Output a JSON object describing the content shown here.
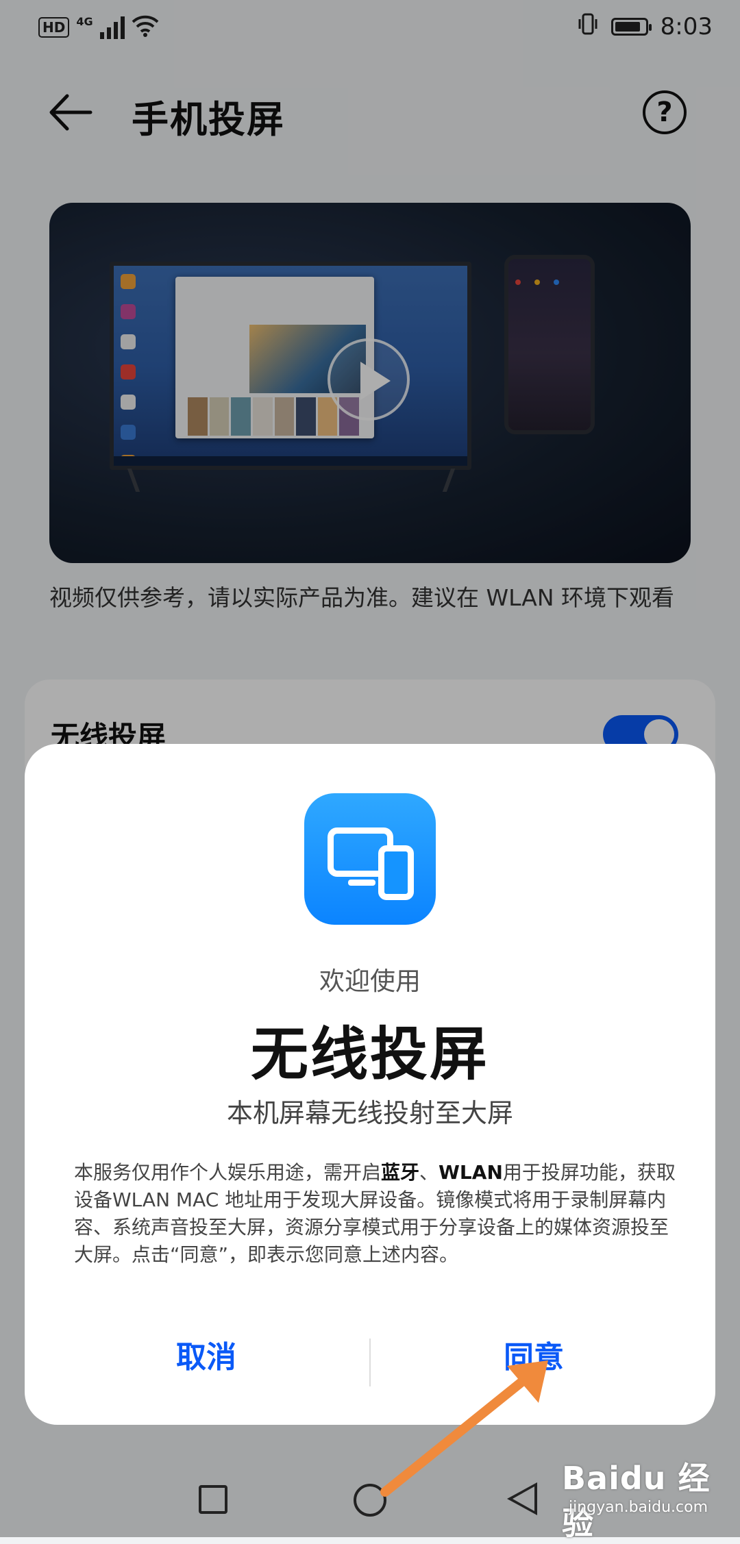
{
  "status_bar": {
    "hd": "HD",
    "network": "4G",
    "time": "8:03",
    "battery_level": 0.85
  },
  "header": {
    "title": "手机投屏",
    "back_icon": "arrow-left-icon",
    "help_icon": "question-circle-icon",
    "help_glyph": "?"
  },
  "video": {
    "caption": "视频仅供参考，请以实际产品为准。建议在 WLAN 环境下观看"
  },
  "card": {
    "title": "无线投屏",
    "toggle_on": true
  },
  "dialog": {
    "welcome": "欢迎使用",
    "title": "无线投屏",
    "subtitle": "本机屏幕无线投射至大屏",
    "body_parts": {
      "p1": "本服务仅用作个人娱乐用途，需开启",
      "bold1": "蓝牙",
      "p2": "、",
      "bold2": "WLAN",
      "p3": "用于投屏功能，获取设备WLAN MAC 地址用于发现大屏设备。镜像模式将用于录制屏幕内容、系统声音投至大屏，资源分享模式用于分享设备上的媒体资源投至大屏。点击“同意”，即表示您同意上述内容。"
    },
    "cancel_label": "取消",
    "agree_label": "同意"
  },
  "navbar": {
    "back_icon": "triangle-back-icon",
    "home_icon": "circle-home-icon",
    "recent_icon": "square-recent-icon"
  },
  "watermark": {
    "logo": "Bai",
    "logo_paw": "du",
    "logo_cn": "经验",
    "url": "jingyan.baidu.com"
  },
  "colors": {
    "accent": "#0a59f7",
    "annotation_arrow": "#f08a3c"
  }
}
